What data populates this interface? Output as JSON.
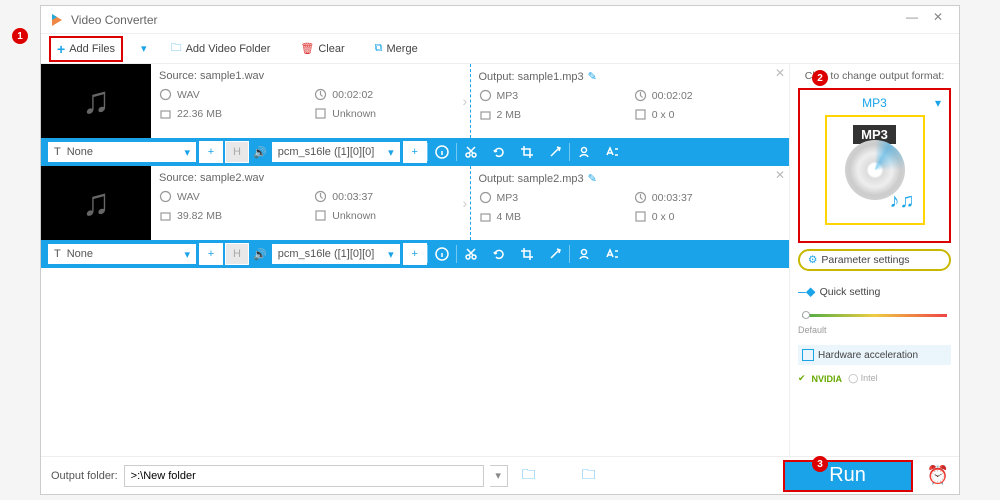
{
  "window": {
    "title": "Video Converter"
  },
  "toolbar": {
    "add_files": "Add Files",
    "add_folder": "Add Video Folder",
    "clear": "Clear",
    "merge": "Merge"
  },
  "items": [
    {
      "source": {
        "label": "Source: sample1.wav",
        "format": "WAV",
        "duration": "00:02:02",
        "size": "22.36 MB",
        "resolution": "Unknown"
      },
      "output": {
        "label": "Output: sample1.mp3",
        "format": "MP3",
        "duration": "00:02:02",
        "size": "2 MB",
        "resolution": "0 x 0"
      },
      "effect": "None",
      "codec": "pcm_s16le ([1][0][0]"
    },
    {
      "source": {
        "label": "Source: sample2.wav",
        "format": "WAV",
        "duration": "00:03:37",
        "size": "39.82 MB",
        "resolution": "Unknown"
      },
      "output": {
        "label": "Output: sample2.mp3",
        "format": "MP3",
        "duration": "00:03:37",
        "size": "4 MB",
        "resolution": "0 x 0"
      },
      "effect": "None",
      "codec": "pcm_s16le ([1][0][0]"
    }
  ],
  "side": {
    "click_label": "Click to change output format:",
    "format": "MP3",
    "tag": "MP3",
    "param": "Parameter settings",
    "quick": "Quick setting",
    "slider_lbl": "Default",
    "hw": "Hardware acceleration",
    "nvidia": "NVIDIA",
    "intel": "Intel"
  },
  "footer": {
    "label": "Output folder:",
    "path": ">:\\New folder",
    "run": "Run"
  },
  "annot": {
    "a1": "1",
    "a2": "2",
    "a3": "3"
  }
}
